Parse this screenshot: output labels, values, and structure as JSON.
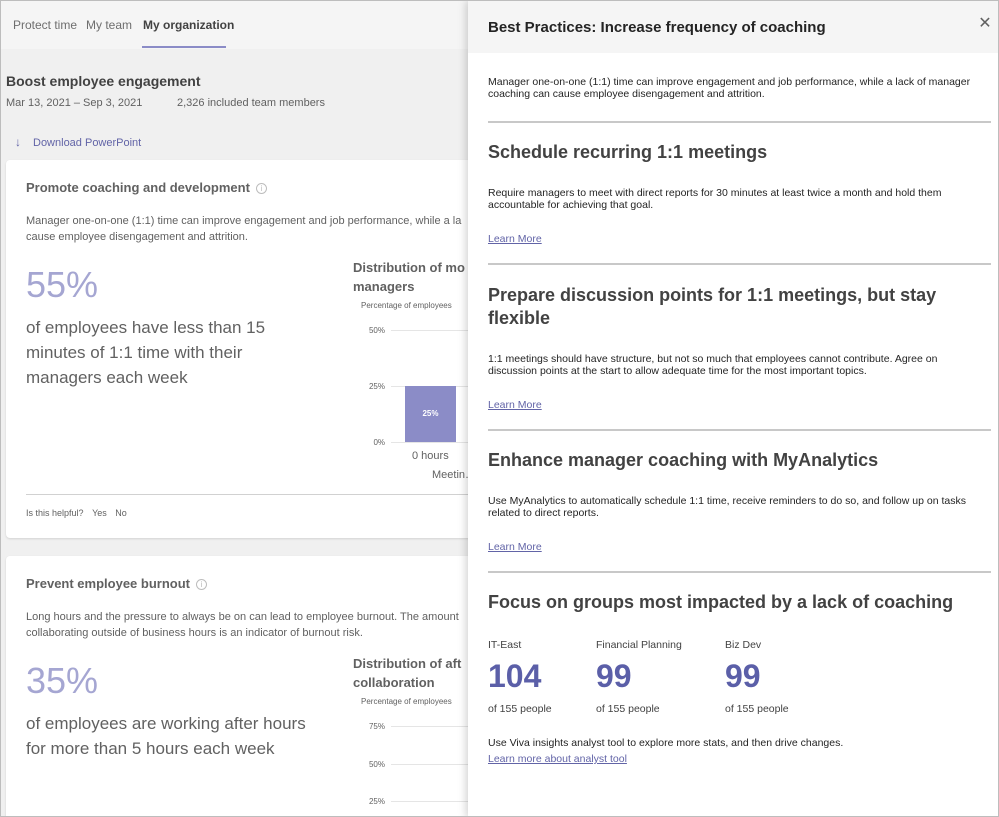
{
  "tabs": [
    {
      "label": "Protect time"
    },
    {
      "label": "My team"
    },
    {
      "label": "My organization"
    }
  ],
  "section": {
    "title": "Boost employee engagement",
    "date_range": "Mar 13, 2021 – Sep 3, 2021",
    "members": "2,326 included team members",
    "download_label": "Download PowerPoint"
  },
  "card1": {
    "title": "Promote coaching and development",
    "description": "Manager one-on-one (1:1) time can improve engagement and job performance, while a lack of manager coaching can cause employee disengagement and attrition.",
    "description_line1": "Manager one-on-one (1:1) time can improve engagement and job performance, while a la",
    "description_line2": "cause employee disengagement and attrition.",
    "stat": "55%",
    "stat_text": "of employees have less than 15 minutes of 1:1 time with their managers each week",
    "chart_title_line1": "Distribution of mo",
    "chart_title_line2": "managers",
    "chart_subtitle": "Percentage of employees",
    "helpful_label": "Is this helpful?",
    "yes": "Yes",
    "no": "No"
  },
  "card2": {
    "title": "Prevent employee burnout",
    "description_line1": "Long hours and the pressure to always be on can lead to employee burnout. The amount",
    "description_line2": "collaborating outside of business hours is an indicator of burnout risk.",
    "stat": "35%",
    "stat_text": "of employees are working after hours for more than 5 hours each week",
    "chart_title_line1": "Distribution of aft",
    "chart_title_line2": "collaboration",
    "chart_subtitle": "Percentage of employees"
  },
  "chart_data": [
    {
      "type": "bar",
      "title": "Distribution of mo… managers",
      "ylabel": "Percentage of employees",
      "xlabel": "Meetin…",
      "categories": [
        "0 hours"
      ],
      "values": [
        25
      ],
      "data_labels": [
        "25%"
      ],
      "yticks": [
        "50%",
        "25%",
        "0%"
      ],
      "ylim": [
        0,
        50
      ]
    },
    {
      "type": "bar",
      "title": "Distribution of aft… collaboration",
      "ylabel": "Percentage of employees",
      "yticks": [
        "75%",
        "50%",
        "25%"
      ]
    }
  ],
  "panel": {
    "title": "Best Practices: Increase frequency of coaching",
    "intro": "Manager one-on-one (1:1) time can improve engagement and job performance, while a lack of manager coaching can cause employee disengagement and attrition.",
    "sections": [
      {
        "heading": "Schedule recurring 1:1 meetings",
        "body": "Require managers to meet with direct reports for 30 minutes at least twice a month and hold them accountable for achieving that goal.",
        "link": "Learn More"
      },
      {
        "heading": "Prepare discussion points for 1:1 meetings, but stay flexible",
        "body": "1:1 meetings should have structure, but not so much that employees cannot contribute. Agree on discussion points at the start to allow adequate time for the most important topics.",
        "link": "Learn More"
      },
      {
        "heading": "Enhance manager coaching with MyAnalytics",
        "body": "Use MyAnalytics to automatically schedule 1:1 time, receive reminders to do so, and follow up on tasks related to direct reports.",
        "link": "Learn More"
      }
    ],
    "groups_heading": "Focus on groups most impacted by a lack of coaching",
    "groups": [
      {
        "name": "IT-East",
        "count": "104",
        "of": "of 155 people"
      },
      {
        "name": "Financial Planning",
        "count": "99",
        "of": "of 155 people"
      },
      {
        "name": "Biz Dev",
        "count": "99",
        "of": "of 155 people"
      }
    ],
    "footer": "Use Viva insights analyst tool to explore more stats, and then drive changes.",
    "footer_link": "Learn more about analyst tool"
  },
  "colors": {
    "accent": "#6264a7",
    "bar": "#8b8cc7",
    "stat": "#a5a6d2",
    "group_number": "#5b5fa8"
  }
}
